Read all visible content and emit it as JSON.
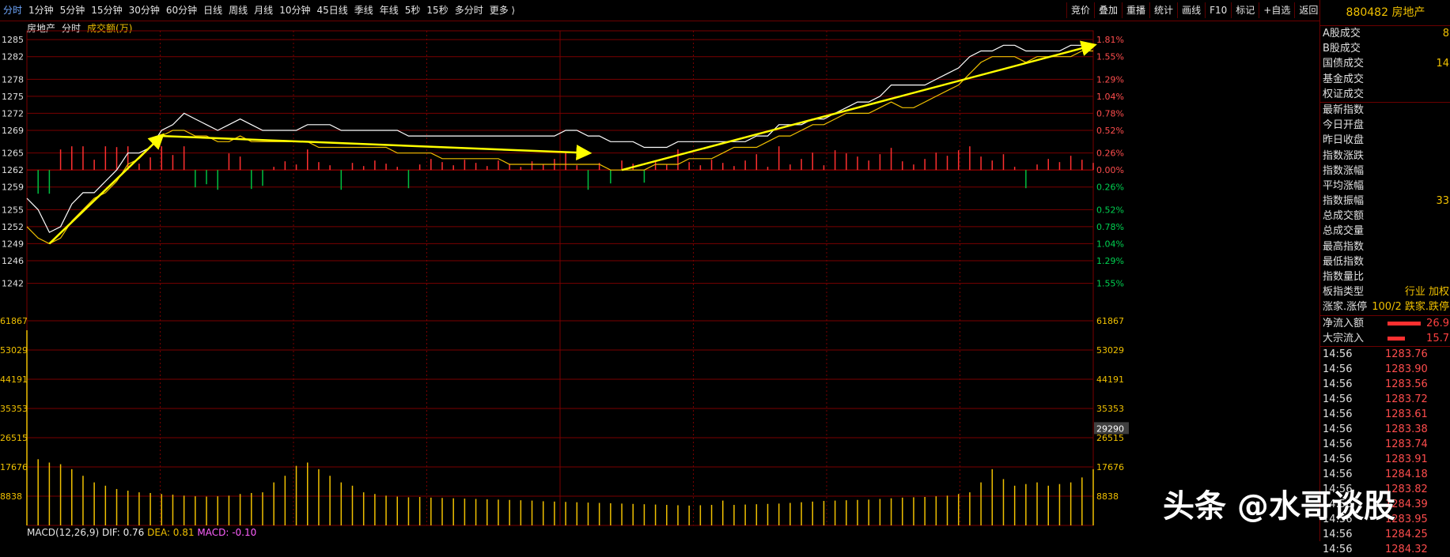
{
  "toolbar": {
    "periods": [
      "分时",
      "1分钟",
      "5分钟",
      "15分钟",
      "30分钟",
      "60分钟",
      "日线",
      "周线",
      "月线",
      "10分钟",
      "45日线",
      "季线",
      "年线",
      "5秒",
      "15秒",
      "多分时",
      "更多 ⟩"
    ],
    "buttons": [
      "竞价",
      "叠加",
      "重播",
      "统计",
      "画线",
      "F10",
      "标记",
      "+自选",
      "返回"
    ]
  },
  "info": {
    "name": "房地产",
    "mode": "分时",
    "volume_label": "成交额(万)"
  },
  "panel": {
    "header": "880482 房地产",
    "rows": [
      {
        "label": "A股成交",
        "value": "8"
      },
      {
        "label": "B股成交",
        "value": ""
      },
      {
        "label": "国债成交",
        "value": "14"
      },
      {
        "label": "基金成交",
        "value": ""
      },
      {
        "label": "权证成交",
        "value": ""
      }
    ],
    "rows2": [
      {
        "label": "最新指数",
        "value": ""
      },
      {
        "label": "今日开盘",
        "value": ""
      },
      {
        "label": "昨日收盘",
        "value": ""
      },
      {
        "label": "指数涨跌",
        "value": ""
      },
      {
        "label": "指数涨幅",
        "value": ""
      },
      {
        "label": "平均涨幅",
        "value": ""
      },
      {
        "label": "指数振幅",
        "value": "33"
      },
      {
        "label": "总成交额",
        "value": ""
      },
      {
        "label": "总成交量",
        "value": ""
      },
      {
        "label": "最高指数",
        "value": ""
      },
      {
        "label": "最低指数",
        "value": ""
      },
      {
        "label": "指数量比",
        "value": ""
      },
      {
        "label": "板指类型",
        "value": "行业 加权"
      },
      {
        "label": "涨家.涨停",
        "value": "100/2 跌家.跌停"
      }
    ],
    "flows": [
      {
        "label": "净流入额",
        "value": "26.9"
      },
      {
        "label": "大宗流入",
        "value": "15.7"
      }
    ],
    "ticks": [
      {
        "time": "14:56",
        "price": "1283.76"
      },
      {
        "time": "14:56",
        "price": "1283.90"
      },
      {
        "time": "14:56",
        "price": "1283.56"
      },
      {
        "time": "14:56",
        "price": "1283.72"
      },
      {
        "time": "14:56",
        "price": "1283.61"
      },
      {
        "time": "14:56",
        "price": "1283.38"
      },
      {
        "time": "14:56",
        "price": "1283.74"
      },
      {
        "time": "14:56",
        "price": "1283.91"
      },
      {
        "time": "14:56",
        "price": "1284.18"
      },
      {
        "time": "14:56",
        "price": "1283.82"
      },
      {
        "time": "14:56",
        "price": "1284.39"
      },
      {
        "time": "14:56",
        "price": "1283.95"
      },
      {
        "time": "14:56",
        "price": "1284.25"
      },
      {
        "time": "14:56",
        "price": "1284.32"
      }
    ]
  },
  "macd": {
    "label": "MACD(12,26,9)",
    "dif": "DIF: 0.76",
    "dea": "DEA: 0.81",
    "macd": "MACD: -0.10"
  },
  "watermark": "头条 @水哥谈股",
  "colors": {
    "price_line": "#ffffff",
    "avg_line": "#f0c000",
    "up": "#ff3030",
    "down": "#00c040",
    "grid": "#7a0000",
    "arrow": "#ffff00"
  },
  "chart_data": {
    "type": "line",
    "price_axis": {
      "ticks": [
        1285,
        1282,
        1278,
        1275,
        1272,
        1269,
        1265,
        1262,
        1259,
        1255,
        1252,
        1249,
        1246,
        1242
      ],
      "labels": [
        "1285",
        "1282",
        "1278",
        "1275",
        "1272",
        "1269",
        "1265",
        "1262",
        "1259",
        "1255",
        "1252",
        "1249",
        "1246",
        "1242"
      ],
      "ylim": [
        1240,
        1286
      ]
    },
    "pct_axis": {
      "labels_up": [
        "1.81%",
        "1.55%",
        "1.29%",
        "1.04%",
        "0.78%",
        "0.52%",
        "0.26%",
        "0.00%"
      ],
      "labels_down": [
        "0.26%",
        "0.52%",
        "0.78%",
        "1.04%",
        "1.29%",
        "1.55%"
      ]
    },
    "volume_axis": {
      "labels": [
        "61867",
        "53029",
        "44191",
        "35353",
        "26515",
        "17676",
        "8838"
      ],
      "ylim": [
        0,
        70705
      ],
      "current": "29290"
    },
    "series": [
      {
        "name": "price",
        "key": "price",
        "values": [
          1257,
          1255,
          1251,
          1252,
          1256,
          1258,
          1258,
          1260,
          1262,
          1265,
          1265,
          1266,
          1269,
          1270,
          1272,
          1271,
          1270,
          1269,
          1270,
          1271,
          1270,
          1269,
          1269,
          1269,
          1269,
          1270,
          1270,
          1270,
          1269,
          1269,
          1269,
          1269,
          1269,
          1269,
          1268,
          1268,
          1268,
          1268,
          1268,
          1268,
          1268,
          1268,
          1268,
          1268,
          1268,
          1268,
          1268,
          1268,
          1269,
          1269,
          1268,
          1268,
          1267,
          1267,
          1267,
          1266,
          1266,
          1266,
          1267,
          1267,
          1267,
          1267,
          1267,
          1267,
          1267,
          1268,
          1268,
          1270,
          1270,
          1270,
          1271,
          1271,
          1272,
          1273,
          1274,
          1274,
          1275,
          1277,
          1277,
          1277,
          1277,
          1278,
          1279,
          1280,
          1282,
          1283,
          1283,
          1284,
          1284,
          1283,
          1283,
          1283,
          1283,
          1284,
          1284,
          1284
        ]
      },
      {
        "name": "average",
        "key": "avg",
        "values": [
          1252,
          1250,
          1249,
          1250,
          1253,
          1255,
          1257,
          1258,
          1260,
          1263,
          1264,
          1266,
          1268,
          1269,
          1269,
          1268,
          1268,
          1267,
          1267,
          1268,
          1267,
          1267,
          1267,
          1267,
          1267,
          1267,
          1266,
          1266,
          1266,
          1266,
          1266,
          1266,
          1266,
          1265,
          1265,
          1265,
          1265,
          1264,
          1264,
          1264,
          1264,
          1264,
          1264,
          1263,
          1263,
          1263,
          1263,
          1263,
          1263,
          1263,
          1263,
          1263,
          1262,
          1262,
          1262,
          1262,
          1263,
          1263,
          1263,
          1264,
          1264,
          1264,
          1265,
          1266,
          1266,
          1266,
          1267,
          1268,
          1268,
          1269,
          1270,
          1270,
          1271,
          1272,
          1272,
          1272,
          1273,
          1274,
          1273,
          1273,
          1274,
          1275,
          1276,
          1277,
          1279,
          1281,
          1282,
          1282,
          1282,
          1281,
          1282,
          1282,
          1282,
          1282,
          1283,
          1283
        ]
      }
    ],
    "base_price": 1262,
    "volume": [
      59000,
      20000,
      19000,
      18500,
      17000,
      15000,
      13000,
      12000,
      11000,
      10500,
      10000,
      9800,
      9500,
      9300,
      9000,
      8800,
      8700,
      8800,
      9000,
      9500,
      9800,
      10000,
      13000,
      15000,
      18000,
      19000,
      17000,
      15000,
      13000,
      12000,
      10000,
      9500,
      9000,
      8700,
      8500,
      8600,
      8400,
      8300,
      8200,
      8100,
      8000,
      7900,
      7800,
      7700,
      7600,
      7500,
      7300,
      7200,
      7100,
      7000,
      6900,
      6800,
      6700,
      6600,
      6500,
      6400,
      6300,
      6200,
      6100,
      6000,
      6100,
      6200,
      7500,
      6200,
      6300,
      6400,
      6500,
      6600,
      6800,
      7000,
      7200,
      7400,
      7500,
      7600,
      7700,
      7800,
      8000,
      8200,
      8400,
      8500,
      8600,
      8800,
      9000,
      9500,
      10000,
      13000,
      17000,
      14000,
      12000,
      12500,
      13000,
      12000,
      12500,
      13000,
      14500,
      17000
    ],
    "arrows": [
      {
        "from": [
          2,
          1249
        ],
        "to": [
          12,
          1268
        ]
      },
      {
        "from": [
          12,
          1268
        ],
        "to": [
          50,
          1265
        ]
      },
      {
        "from": [
          53,
          1262
        ],
        "to": [
          95,
          1284
        ]
      }
    ]
  }
}
